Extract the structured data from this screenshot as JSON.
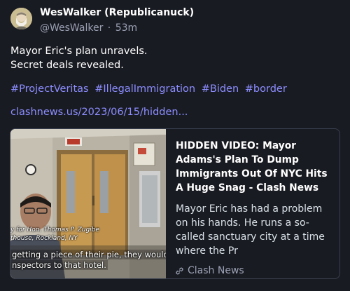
{
  "post": {
    "author": {
      "display_name": "WesWalker (Republicanuck)",
      "handle": "@WesWalker",
      "separator": "·",
      "time": "53m"
    },
    "text_lines": [
      "Mayor Eric's plan unravels.",
      "Secret deals revealed."
    ],
    "hashtags": [
      "#ProjectVeritas",
      "#IllegalImmigration",
      "#Biden",
      "#border"
    ],
    "link": "clashnews.us/2023/06/15/hidden...",
    "card": {
      "title": "HIDDEN VIDEO: Mayor Adams's Plan To Dump Immigrants Out Of NYC Hits A Huge Snag - Clash News",
      "description": "Mayor Eric has had a problem on his hands. He runs a so-called sanctuary city at a time where the Pr",
      "source": "Clash News",
      "image_captions": {
        "name_line1": "y for Hon. Thomas P. Zugibe",
        "name_line2": "thouse, Rockland, NY",
        "subtitle_line1": "getting a piece of their pie, they would",
        "subtitle_line2": "nspectors to that hotel."
      }
    }
  },
  "colors": {
    "background": "#191b22",
    "link": "#8c8dff",
    "muted": "#9ba1b4",
    "card_border": "#393f4f"
  },
  "icons": {
    "source": "link-icon",
    "avatar": "avatar-image"
  }
}
